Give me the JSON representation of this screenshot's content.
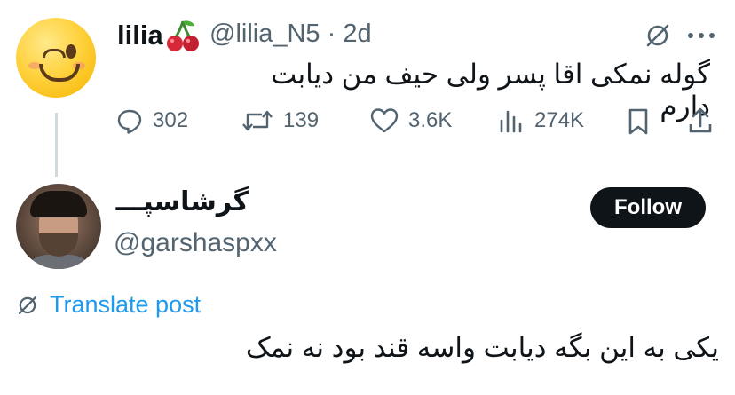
{
  "parent_tweet": {
    "author_name": "lilia",
    "author_handle": "@lilia_N5",
    "separator": "·",
    "time_ago": "2d",
    "text": "گوله نمکی اقا پسر ولی حیف من دیابت دارم",
    "stats": {
      "replies": "302",
      "retweets": "139",
      "likes": "3.6K",
      "views": "274K"
    }
  },
  "reply_tweet": {
    "author_name": "گرشاسپـــ",
    "author_handle": "@garshaspxx",
    "follow_label": "Follow",
    "translate_label": "Translate post",
    "text": "یکی به این بگه دیابت واسه قند بود نه نمک"
  },
  "colors": {
    "muted": "#536471",
    "link": "#1d9bf0",
    "cherry": "#d62839",
    "button_bg": "#0f1419"
  }
}
